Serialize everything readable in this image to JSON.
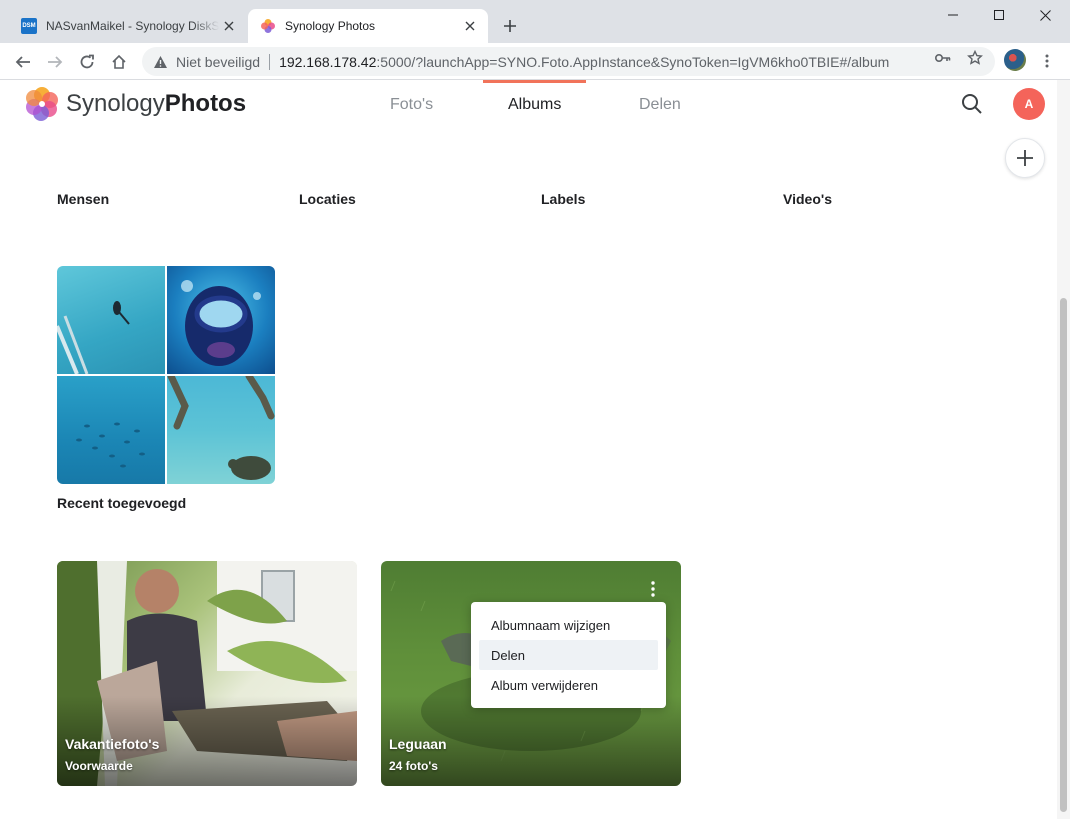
{
  "browser": {
    "tabs": [
      {
        "title": "NASvanMaikel - Synology DiskStation",
        "favicon_text": "DSM",
        "active": false
      },
      {
        "title": "Synology Photos",
        "active": true
      }
    ],
    "window_controls": [
      "minimize",
      "maximize",
      "close"
    ],
    "not_secure_label": "Niet beveiligd",
    "url_host": "192.168.178.42",
    "url_rest": ":5000/?launchApp=SYNO.Foto.AppInstance&SynoToken=IgVM6kho0TBIE#/album"
  },
  "app": {
    "brand_light": "Synology",
    "brand_bold": "Photos",
    "nav_tabs": [
      {
        "label": "Foto's",
        "active": false
      },
      {
        "label": "Albums",
        "active": true
      },
      {
        "label": "Delen",
        "active": false
      }
    ],
    "avatar_initial": "A",
    "accent_color": "#f1735a"
  },
  "categories": [
    "Mensen",
    "Locaties",
    "Labels",
    "Video's"
  ],
  "recent": {
    "title": "Recent toegevoegd"
  },
  "albums": [
    {
      "name": "Vakantiefoto's",
      "subtitle": "Voorwaarde"
    },
    {
      "name": "Leguaan",
      "subtitle": "24 foto's"
    }
  ],
  "context_menu": {
    "items": [
      {
        "label": "Albumnaam wijzigen",
        "hovered": false
      },
      {
        "label": "Delen",
        "hovered": true
      },
      {
        "label": "Album verwijderen",
        "hovered": false
      }
    ]
  }
}
